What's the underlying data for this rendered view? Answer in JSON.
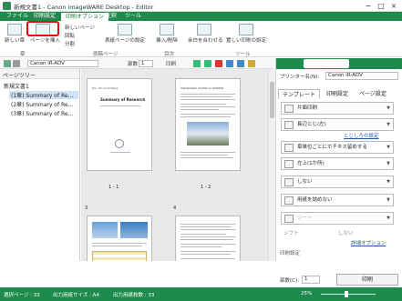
{
  "title": "新規文書1 - Canon imageWARE Desktop - Editor",
  "menu": [
    "ファイル",
    "印刷設定",
    "印刷オプション",
    "注釈",
    "ツール"
  ],
  "ribbon": {
    "new_label": "新しい章",
    "select_label": "ページを挿入",
    "new_page": "新しいページ",
    "rotate": "回転",
    "split": "分割",
    "display_settings": "表紙ページの設定",
    "insert_edit": "挿入/削除",
    "combine": "余白を合わせる",
    "save_print": "置しい印刷の設定"
  },
  "group_labels": {
    "chapter": "章",
    "page": "原稿ページ",
    "toc": "目次",
    "tools": "ツール"
  },
  "toolbar": {
    "printer": "Canon iR-ADV",
    "copies_label": "部数",
    "copies": "1",
    "print": "印刷"
  },
  "sidebar": {
    "title": "ページツリー",
    "items": [
      "新規文書1",
      "(1章) Summary of Re...",
      "(2章) Summary of Re...",
      "(3章) Summary of Re..."
    ]
  },
  "pages": [
    {
      "num": "1 - 1",
      "org": "Pro. XX Committee",
      "heading": "Summary of Research"
    },
    {
      "num": "1 - 2",
      "heading": "Introduction of XXX on XXXXXX"
    },
    {
      "num": "3",
      "heading": ""
    },
    {
      "num": "4",
      "heading": ""
    }
  ],
  "right_panel": {
    "printer_label": "プリンター名(N):",
    "printer_name": "Canon iR-ADV",
    "tabs": [
      "テンプレート",
      "印刷設定",
      "ページ設定"
    ],
    "settings": [
      "片面印刷",
      "長辺とじ(左)",
      "単章印刷",
      "章単位ごとにホチキス留めする",
      "左上(1か所)",
      "しない",
      "用紙を詰めない",
      "シート"
    ],
    "detail_link": "とじしろの設定",
    "shift": "シフト",
    "none": "しない",
    "detail_options": "詳細オプション",
    "print_settings": "印刷設定",
    "copies_label": "部数(C):",
    "copies": "1",
    "print_button": "印刷"
  },
  "status": {
    "selected": "選択ページ : 33",
    "output_size": "出力用紙サイズ : A4",
    "output_pages": "出力用紙枚数 : 33",
    "zoom": "25%"
  }
}
